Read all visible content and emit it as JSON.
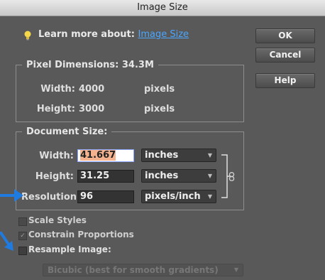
{
  "window": {
    "title": "Image Size"
  },
  "learn": {
    "prefix": "Learn more about:",
    "link": "Image Size"
  },
  "buttons": {
    "ok": "OK",
    "cancel": "Cancel",
    "help": "Help"
  },
  "pixel_dimensions": {
    "legend": "Pixel Dimensions:  34.3M",
    "width_label": "Width:",
    "width_value": "4000",
    "width_unit": "pixels",
    "height_label": "Height:",
    "height_value": "3000",
    "height_unit": "pixels"
  },
  "document_size": {
    "legend": "Document Size:",
    "width_label": "Width:",
    "width_value": "41.667",
    "width_unit": "inches",
    "height_label": "Height:",
    "height_value": "31.25",
    "height_unit": "inches",
    "resolution_label": "Resolution:",
    "resolution_value": "96",
    "resolution_unit": "pixels/inch"
  },
  "options": {
    "scale_styles": {
      "label": "Scale Styles",
      "checked": false
    },
    "constrain": {
      "label": "Constrain Proportions",
      "checked": true
    },
    "resample": {
      "label": "Resample Image:",
      "checked": false
    }
  },
  "resample_method": "Bicubic (best for smooth gradients)",
  "colors": {
    "link": "#4aa6ff",
    "annotation_arrow": "#1f7be0",
    "panel": "#595959"
  },
  "icons": [
    "lightbulb-icon",
    "chain-link-icon",
    "dropdown-arrow-icon",
    "checkmark-icon"
  ]
}
